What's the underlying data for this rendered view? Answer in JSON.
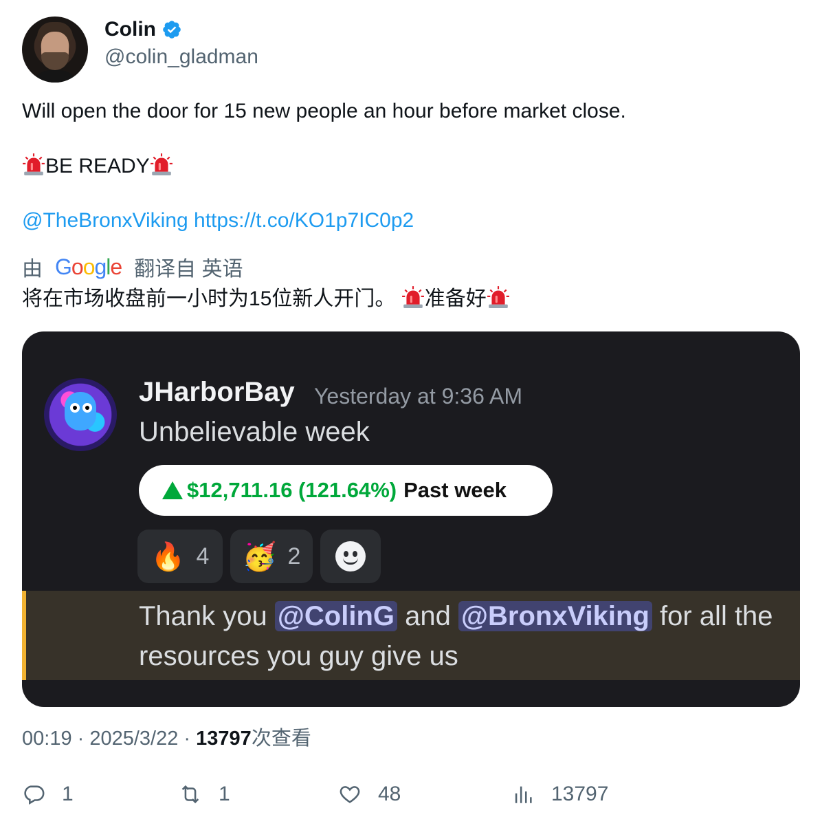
{
  "author": {
    "display_name": "Colin",
    "handle": "@colin_gladman",
    "verified": true
  },
  "tweet": {
    "text_line1": "Will open the door for 15 new people an hour before market close.",
    "be_ready": "BE READY",
    "mention_link": "@TheBronxViking",
    "url_link": "https://t.co/KO1p7IC0p2"
  },
  "translation": {
    "prefix": "由",
    "provider": "Google",
    "suffix": "翻译自 英语",
    "text_part1": "将在市场收盘前一小时为15位新人开门。",
    "text_part2": "准备好"
  },
  "embedded_image": {
    "username": "JHarborBay",
    "timestamp": "Yesterday at 9:36 AM",
    "message": "Unbelievable week",
    "gain_value": "$12,711.16 (121.64%)",
    "gain_period": "Past week",
    "reactions": [
      {
        "emoji": "🔥",
        "count": "4"
      },
      {
        "emoji": "🥳",
        "count": "2"
      }
    ],
    "reply_text_1": "Thank you",
    "reply_mention_1": "@ColinG",
    "reply_text_2": "and",
    "reply_mention_2": "@BronxViking",
    "reply_text_3": "for all the resources you guy give us"
  },
  "meta": {
    "time": "00:19",
    "date": "2025/3/22",
    "views": "13797",
    "views_suffix": "次查看"
  },
  "actions": {
    "replies": "1",
    "reposts": "1",
    "likes": "48",
    "views": "13797"
  },
  "colors": {
    "link": "#1d9bf0",
    "secondary_text": "#536471",
    "gain_green": "#00a83a",
    "mention_highlight": "#505cdc"
  }
}
